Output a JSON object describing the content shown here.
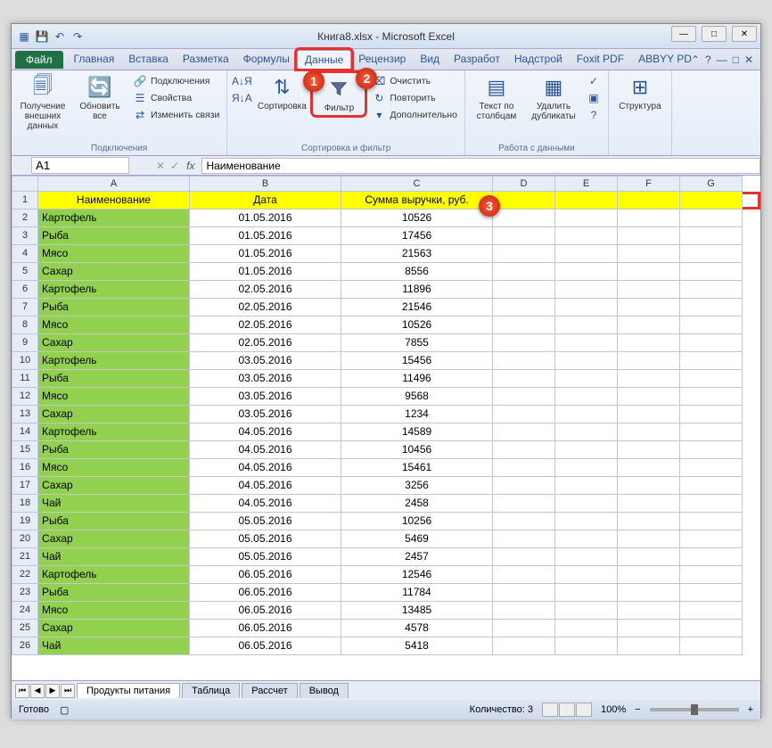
{
  "title": "Книга8.xlsx - Microsoft Excel",
  "qat": {
    "save": "💾",
    "undo": "↶",
    "redo": "↷"
  },
  "wincontrols": {
    "min": "—",
    "max": "□",
    "close": "✕"
  },
  "tabs": {
    "file": "Файл",
    "items": [
      "Главная",
      "Вставка",
      "Разметка",
      "Формулы",
      "Данные",
      "Рецензир",
      "Вид",
      "Разработ",
      "Надстрой",
      "Foxit PDF",
      "ABBYY PD"
    ],
    "active_index": 4
  },
  "ribbon": {
    "g1": {
      "label": "Подключения",
      "big1": "Получение внешних данных",
      "big2": "Обновить все",
      "s1": "Подключения",
      "s2": "Свойства",
      "s3": "Изменить связи"
    },
    "g2": {
      "label": "Сортировка и фильтр",
      "sort_az": "А↓Я",
      "sort_za": "Я↓А",
      "big_sort": "Сортировка",
      "big_filter": "Фильтр",
      "s1": "Очистить",
      "s2": "Повторить",
      "s3": "Дополнительно"
    },
    "g3": {
      "label": "Работа с данными",
      "big1": "Текст по столбцам",
      "big2": "Удалить дубликаты"
    },
    "g4": {
      "label": "",
      "big1": "Структура"
    }
  },
  "namebox": "A1",
  "formula": "Наименование",
  "cols": [
    "A",
    "B",
    "C",
    "D",
    "E",
    "F",
    "G"
  ],
  "headers": [
    "Наименование",
    "Дата",
    "Сумма выручки, руб."
  ],
  "chart_data": {
    "type": "table",
    "columns": [
      "Наименование",
      "Дата",
      "Сумма выручки, руб."
    ],
    "rows": [
      [
        "Картофель",
        "01.05.2016",
        10526
      ],
      [
        "Рыба",
        "01.05.2016",
        17456
      ],
      [
        "Мясо",
        "01.05.2016",
        21563
      ],
      [
        "Сахар",
        "01.05.2016",
        8556
      ],
      [
        "Картофель",
        "02.05.2016",
        11896
      ],
      [
        "Рыба",
        "02.05.2016",
        21546
      ],
      [
        "Мясо",
        "02.05.2016",
        10526
      ],
      [
        "Сахар",
        "02.05.2016",
        7855
      ],
      [
        "Картофель",
        "03.05.2016",
        15456
      ],
      [
        "Рыба",
        "03.05.2016",
        11496
      ],
      [
        "Мясо",
        "03.05.2016",
        9568
      ],
      [
        "Сахар",
        "03.05.2016",
        1234
      ],
      [
        "Картофель",
        "04.05.2016",
        14589
      ],
      [
        "Рыба",
        "04.05.2016",
        10456
      ],
      [
        "Мясо",
        "04.05.2016",
        15461
      ],
      [
        "Сахар",
        "04.05.2016",
        3256
      ],
      [
        "Чай",
        "04.05.2016",
        2458
      ],
      [
        "Рыба",
        "05.05.2016",
        10256
      ],
      [
        "Сахар",
        "05.05.2016",
        5469
      ],
      [
        "Чай",
        "05.05.2016",
        2457
      ],
      [
        "Картофель",
        "06.05.2016",
        12546
      ],
      [
        "Рыба",
        "06.05.2016",
        11784
      ],
      [
        "Мясо",
        "06.05.2016",
        13485
      ],
      [
        "Сахар",
        "06.05.2016",
        4578
      ],
      [
        "Чай",
        "06.05.2016",
        5418
      ]
    ]
  },
  "sheets": [
    "Продукты питания",
    "Таблица",
    "Рассчет",
    "Вывод"
  ],
  "status": {
    "ready": "Готово",
    "count_lbl": "Количество: 3",
    "zoom": "100%"
  },
  "badges": {
    "b1": "1",
    "b2": "2",
    "b3": "3"
  }
}
